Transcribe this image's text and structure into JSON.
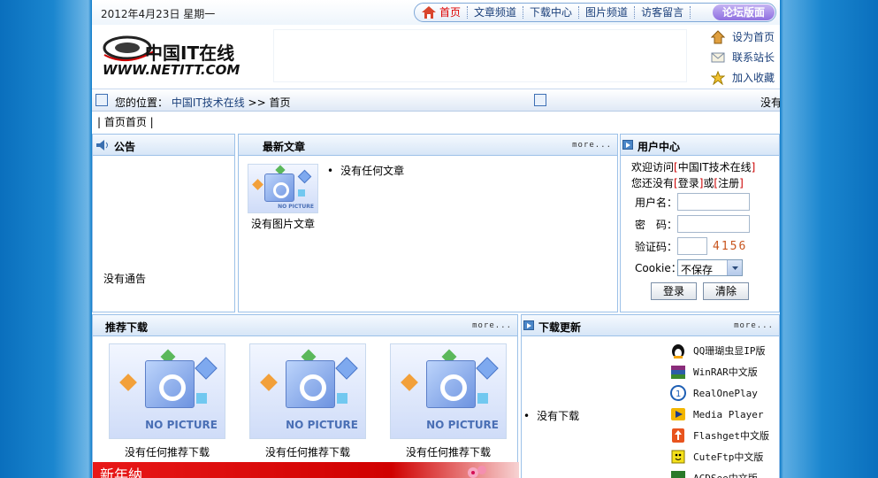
{
  "date": "2012年4月23日 星期一",
  "topnav": {
    "items": [
      "首页",
      "文章频道",
      "下载中心",
      "图片频道",
      "访客留言"
    ],
    "forum": "论坛版面"
  },
  "logo": {
    "cn": "中国IT在线",
    "url": "WWW.NETITT.COM"
  },
  "quick": [
    "设为首页",
    "联系站长",
    "加入收藏"
  ],
  "breadcrumb": {
    "label": "您的位置：",
    "site": "中国IT技术在线",
    "sep": ">>",
    "current": "首页",
    "right_text": "没有"
  },
  "subnav": "| 首页首页 |",
  "notice": {
    "title": "公告",
    "empty": "没有通告"
  },
  "latest": {
    "title": "最新文章",
    "more": "more...",
    "no_pic_text": "没有图片文章",
    "empty": "没有任何文章"
  },
  "user_center": {
    "title": "用户中心",
    "welcome_prefix": "欢迎访问",
    "site_name": "中国IT技术在线",
    "no_account_prefix": "您还没有",
    "login_link": "登录",
    "or": "或",
    "register_link": "注册",
    "username_label": "用户名：",
    "password_label": "密　码：",
    "captcha_label": "验证码：",
    "captcha_value": "4156",
    "cookie_label": "Cookie：",
    "cookie_option": "不保存",
    "login_button": "登录",
    "clear_button": "清除"
  },
  "recommend": {
    "title": "推荐下载",
    "more": "more...",
    "items": [
      "没有任何推荐下载",
      "没有任何推荐下载",
      "没有任何推荐下载"
    ],
    "no_picture": "NO PICTURE"
  },
  "downloads": {
    "title": "下载更新",
    "more": "more...",
    "empty": "没有下载",
    "items": [
      "QQ珊瑚虫显IP版",
      "WinRAR中文版",
      "RealOnePlay",
      "Media Player",
      "Flashget中文版",
      "CuteFtp中文版",
      "ACDSee中文版"
    ]
  },
  "promo_banner": "新年納",
  "colors": {
    "accent_red": "#cc0000",
    "link_blue": "#1a3f7a",
    "panel_border": "#9cc1e8",
    "background_blue": "#0f7cc9"
  }
}
